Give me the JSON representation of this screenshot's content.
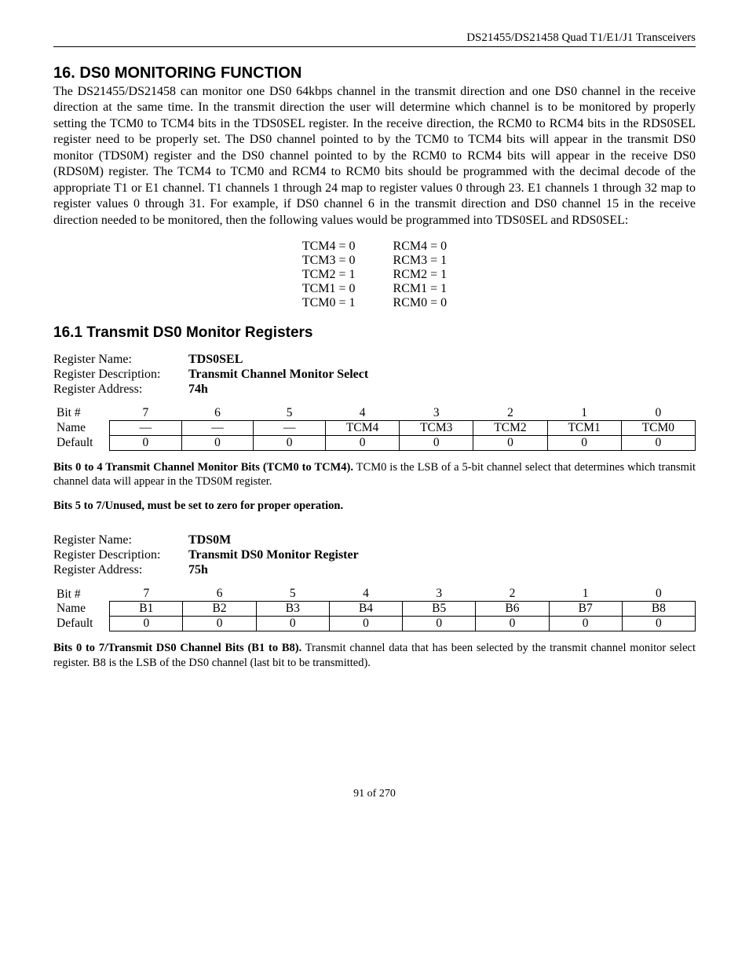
{
  "header": {
    "right_text": "DS21455/DS21458 Quad T1/E1/J1 Transceivers"
  },
  "section": {
    "title": "16.  DS0 MONITORING FUNCTION",
    "body": "The DS21455/DS21458 can monitor one DS0 64kbps channel in the transmit direction and one DS0 channel in the receive direction at the same time. In the transmit direction the user will determine which channel is to be monitored by properly setting the TCM0 to TCM4 bits in the TDS0SEL register. In the receive direction, the RCM0 to RCM4 bits in the RDS0SEL register need to be properly set. The DS0 channel pointed to by the TCM0 to TCM4 bits will appear in the transmit DS0 monitor (TDS0M) register and the DS0 channel pointed to by the RCM0 to RCM4 bits will appear in the receive DS0 (RDS0M) register. The TCM4 to TCM0 and RCM4 to RCM0 bits should be programmed with the decimal decode of the appropriate T1 or E1 channel. T1 channels 1 through 24 map to register values 0 through 23. E1 channels 1 through 32 map to register values 0 through 31. For example, if DS0 channel 6 in the transmit direction and DS0 channel 15 in the receive direction needed to be monitored, then the following values would be programmed into TDS0SEL and RDS0SEL:"
  },
  "example": {
    "rows": [
      {
        "t": "TCM4 = 0",
        "r": "RCM4 = 0"
      },
      {
        "t": "TCM3 = 0",
        "r": "RCM3 = 1"
      },
      {
        "t": "TCM2 = 1",
        "r": "RCM2 = 1"
      },
      {
        "t": "TCM1 = 0",
        "r": "RCM1 = 1"
      },
      {
        "t": "TCM0 = 1",
        "r": "RCM0 = 0"
      }
    ]
  },
  "subsection": {
    "title": "16.1  Transmit DS0 Monitor Registers"
  },
  "reg1": {
    "labels": {
      "name": "Register Name:",
      "desc": "Register Description:",
      "addr": "Register Address:"
    },
    "name": "TDS0SEL",
    "desc": "Transmit Channel Monitor Select",
    "addr": "74h",
    "bit_label": "Bit #",
    "name_label": "Name",
    "default_label": "Default",
    "bitnums": [
      "7",
      "6",
      "5",
      "4",
      "3",
      "2",
      "1",
      "0"
    ],
    "names": [
      "—",
      "—",
      "—",
      "TCM4",
      "TCM3",
      "TCM2",
      "TCM1",
      "TCM0"
    ],
    "defaults": [
      "0",
      "0",
      "0",
      "0",
      "0",
      "0",
      "0",
      "0"
    ],
    "note_bold": "Bits 0 to 4 Transmit Channel Monitor Bits (TCM0 to TCM4).",
    "note_rest": " TCM0 is the LSB of a 5-bit channel select that determines which transmit channel data will appear in the TDS0M register.",
    "note2": "Bits 5 to 7/Unused, must be set to zero for proper operation."
  },
  "reg2": {
    "labels": {
      "name": "Register Name:",
      "desc": "Register Description:",
      "addr": "Register Address:"
    },
    "name": "TDS0M",
    "desc": "Transmit DS0 Monitor Register",
    "addr": "75h",
    "bit_label": "Bit #",
    "name_label": "Name",
    "default_label": "Default",
    "bitnums": [
      "7",
      "6",
      "5",
      "4",
      "3",
      "2",
      "1",
      "0"
    ],
    "names": [
      "B1",
      "B2",
      "B3",
      "B4",
      "B5",
      "B6",
      "B7",
      "B8"
    ],
    "defaults": [
      "0",
      "0",
      "0",
      "0",
      "0",
      "0",
      "0",
      "0"
    ],
    "note_bold": "Bits 0 to 7/Transmit DS0 Channel Bits (B1 to B8).",
    "note_rest": " Transmit channel data that has been selected by the transmit channel monitor select register. B8 is the LSB of the DS0 channel (last bit to be transmitted)."
  },
  "footer": {
    "text": "91 of 270"
  }
}
